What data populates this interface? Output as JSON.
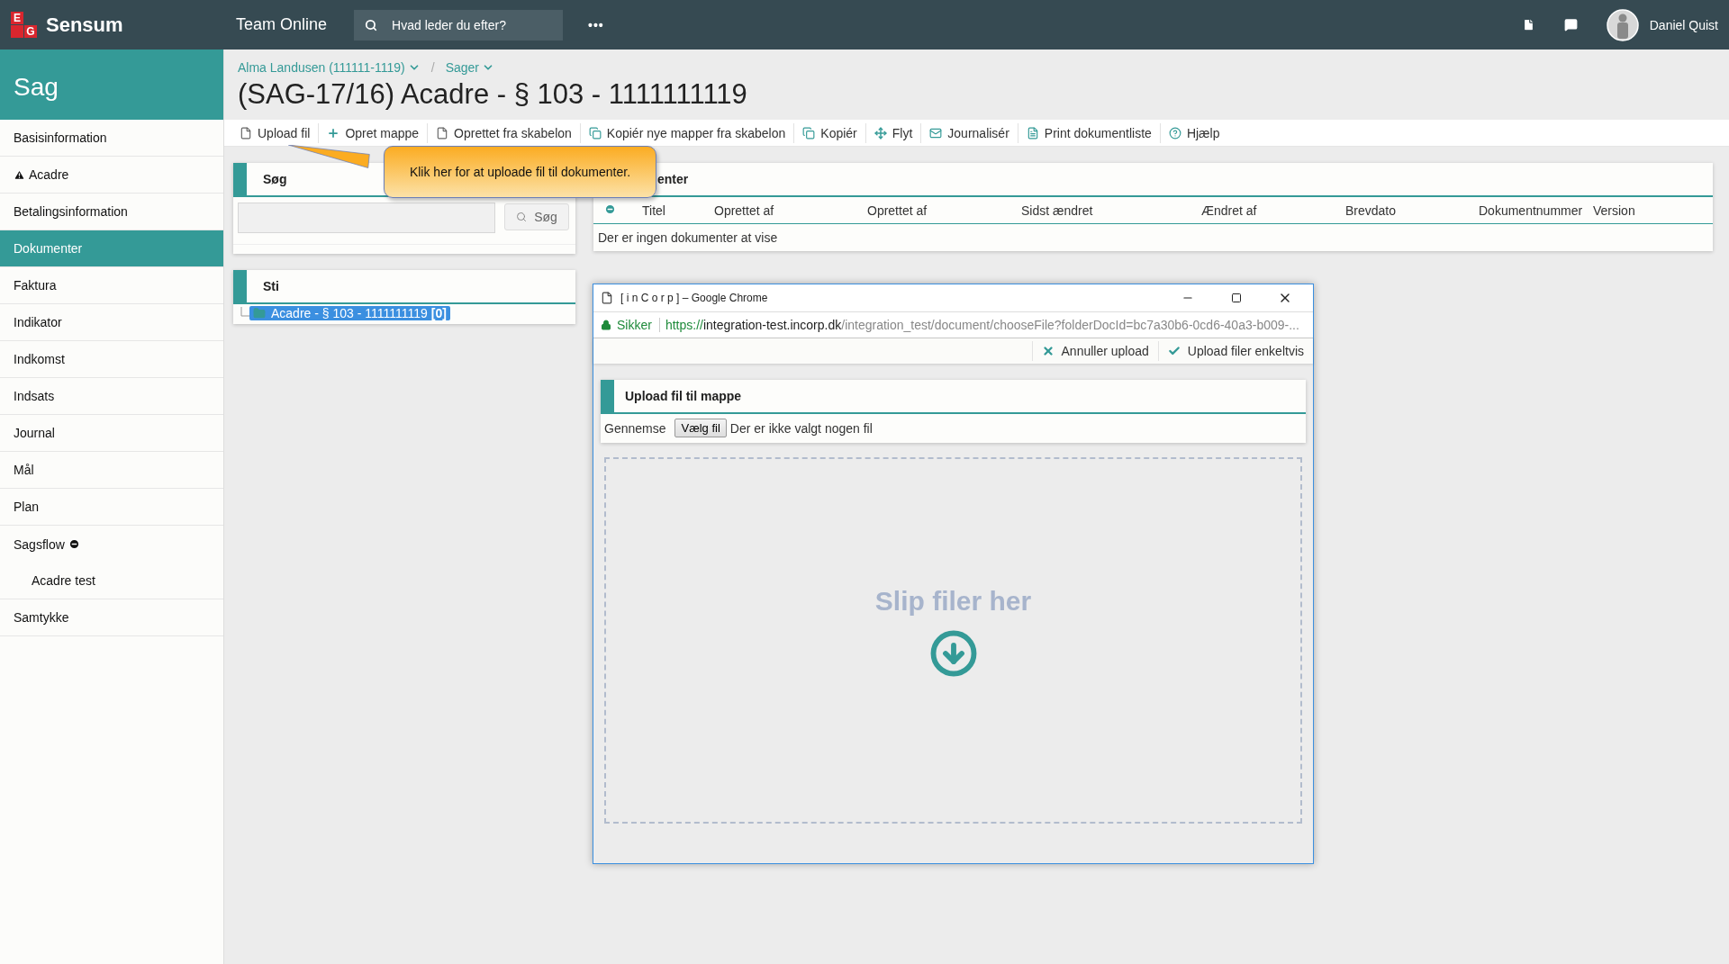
{
  "top_bar": {
    "logo": {
      "letters": [
        "E",
        "G"
      ],
      "name": "Sensum"
    },
    "app_title": "Team Online",
    "search": {
      "placeholder": "Hvad leder du efter?"
    },
    "more": "•••",
    "user": "Daniel Quist"
  },
  "sidebar": {
    "title": "Sag",
    "items": [
      {
        "label": "Basisinformation",
        "kind": "plain",
        "selected": false
      },
      {
        "label": "Acadre",
        "kind": "warning",
        "selected": false
      },
      {
        "label": "Betalingsinformation",
        "kind": "plain",
        "selected": false
      },
      {
        "label": "Dokumenter",
        "kind": "plain",
        "selected": true
      },
      {
        "label": "Faktura",
        "kind": "plain",
        "selected": false
      },
      {
        "label": "Indikator",
        "kind": "plain",
        "selected": false
      },
      {
        "label": "Indkomst",
        "kind": "plain",
        "selected": false
      },
      {
        "label": "Indsats",
        "kind": "plain",
        "selected": false
      },
      {
        "label": "Journal",
        "kind": "plain",
        "selected": false
      },
      {
        "label": "Mål",
        "kind": "plain",
        "selected": false
      },
      {
        "label": "Plan",
        "kind": "plain",
        "selected": false
      },
      {
        "label": "Sagsflow",
        "kind": "collapse",
        "selected": false,
        "children": [
          {
            "label": "Acadre test",
            "selected": false
          }
        ]
      },
      {
        "label": "Samtykke",
        "kind": "plain",
        "selected": false
      }
    ]
  },
  "breadcrumb": [
    "Alma Landusen (111111-1119)",
    "Sager"
  ],
  "breadcrumb_separator": "/",
  "page_title": "(SAG-17/16) Acadre - § 103 - 1111111119",
  "toolbar": [
    {
      "label": "Upload fil",
      "kind": "file"
    },
    {
      "label": "Opret mappe",
      "kind": "plus"
    },
    {
      "label": "Oprettet fra skabelon",
      "kind": "file"
    },
    {
      "label": "Kopiér nye mapper fra skabelon",
      "kind": "copy"
    },
    {
      "label": "Kopiér",
      "kind": "copy"
    },
    {
      "label": "Flyt",
      "kind": "move"
    },
    {
      "label": "Journalisér",
      "kind": "mail"
    },
    {
      "label": "Print dokumentliste",
      "kind": "pdf"
    },
    {
      "label": "Hjælp",
      "kind": "help"
    }
  ],
  "tooltip": "Klik her for at uploade fil til dokumenter.",
  "search_panel": {
    "title": "Søg",
    "button": "Søg"
  },
  "path_panel": {
    "title": "Sti",
    "node": {
      "label": "Acadre - § 103 - 1111111119 **[0]**",
      "selected": true
    }
  },
  "documents_panel": {
    "title": "enter",
    "columns": [
      "Titel",
      "Oprettet af",
      "Oprettet af",
      "Sidst ændret",
      "Ændret af",
      "Brevdato",
      "Dokumentnummer",
      "Version"
    ],
    "empty": "Der er ingen dokumenter at vise"
  },
  "popup": {
    "title": "[ i n C o r p ] – Google Chrome",
    "secure": "Sikker",
    "url": {
      "scheme": "https://",
      "host": "integration-test.incorp.dk",
      "path": "/integration_test/document/chooseFile?folderDocId=bc7a30b6-0cd6-40a3-b009-..."
    },
    "actions": [
      {
        "label": "Annuller upload",
        "kind": "cancel"
      },
      {
        "label": "Upload filer enkeltvis",
        "kind": "check"
      }
    ],
    "panel_title": "Upload fil til mappe",
    "browse_label": "Gennemse",
    "file_button": "Vælg fil",
    "file_status": "Der er ikke valgt nogen fil",
    "drop_text": "Slip filer her"
  }
}
